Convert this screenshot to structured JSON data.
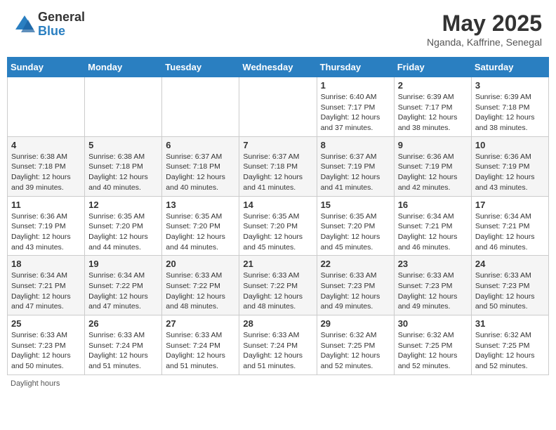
{
  "header": {
    "logo_general": "General",
    "logo_blue": "Blue",
    "month_year": "May 2025",
    "location": "Nganda, Kaffrine, Senegal"
  },
  "days_of_week": [
    "Sunday",
    "Monday",
    "Tuesday",
    "Wednesday",
    "Thursday",
    "Friday",
    "Saturday"
  ],
  "weeks": [
    [
      {
        "day": "",
        "info": ""
      },
      {
        "day": "",
        "info": ""
      },
      {
        "day": "",
        "info": ""
      },
      {
        "day": "",
        "info": ""
      },
      {
        "day": "1",
        "info": "Sunrise: 6:40 AM\nSunset: 7:17 PM\nDaylight: 12 hours and 37 minutes."
      },
      {
        "day": "2",
        "info": "Sunrise: 6:39 AM\nSunset: 7:17 PM\nDaylight: 12 hours and 38 minutes."
      },
      {
        "day": "3",
        "info": "Sunrise: 6:39 AM\nSunset: 7:18 PM\nDaylight: 12 hours and 38 minutes."
      }
    ],
    [
      {
        "day": "4",
        "info": "Sunrise: 6:38 AM\nSunset: 7:18 PM\nDaylight: 12 hours and 39 minutes."
      },
      {
        "day": "5",
        "info": "Sunrise: 6:38 AM\nSunset: 7:18 PM\nDaylight: 12 hours and 40 minutes."
      },
      {
        "day": "6",
        "info": "Sunrise: 6:37 AM\nSunset: 7:18 PM\nDaylight: 12 hours and 40 minutes."
      },
      {
        "day": "7",
        "info": "Sunrise: 6:37 AM\nSunset: 7:18 PM\nDaylight: 12 hours and 41 minutes."
      },
      {
        "day": "8",
        "info": "Sunrise: 6:37 AM\nSunset: 7:19 PM\nDaylight: 12 hours and 41 minutes."
      },
      {
        "day": "9",
        "info": "Sunrise: 6:36 AM\nSunset: 7:19 PM\nDaylight: 12 hours and 42 minutes."
      },
      {
        "day": "10",
        "info": "Sunrise: 6:36 AM\nSunset: 7:19 PM\nDaylight: 12 hours and 43 minutes."
      }
    ],
    [
      {
        "day": "11",
        "info": "Sunrise: 6:36 AM\nSunset: 7:19 PM\nDaylight: 12 hours and 43 minutes."
      },
      {
        "day": "12",
        "info": "Sunrise: 6:35 AM\nSunset: 7:20 PM\nDaylight: 12 hours and 44 minutes."
      },
      {
        "day": "13",
        "info": "Sunrise: 6:35 AM\nSunset: 7:20 PM\nDaylight: 12 hours and 44 minutes."
      },
      {
        "day": "14",
        "info": "Sunrise: 6:35 AM\nSunset: 7:20 PM\nDaylight: 12 hours and 45 minutes."
      },
      {
        "day": "15",
        "info": "Sunrise: 6:35 AM\nSunset: 7:20 PM\nDaylight: 12 hours and 45 minutes."
      },
      {
        "day": "16",
        "info": "Sunrise: 6:34 AM\nSunset: 7:21 PM\nDaylight: 12 hours and 46 minutes."
      },
      {
        "day": "17",
        "info": "Sunrise: 6:34 AM\nSunset: 7:21 PM\nDaylight: 12 hours and 46 minutes."
      }
    ],
    [
      {
        "day": "18",
        "info": "Sunrise: 6:34 AM\nSunset: 7:21 PM\nDaylight: 12 hours and 47 minutes."
      },
      {
        "day": "19",
        "info": "Sunrise: 6:34 AM\nSunset: 7:22 PM\nDaylight: 12 hours and 47 minutes."
      },
      {
        "day": "20",
        "info": "Sunrise: 6:33 AM\nSunset: 7:22 PM\nDaylight: 12 hours and 48 minutes."
      },
      {
        "day": "21",
        "info": "Sunrise: 6:33 AM\nSunset: 7:22 PM\nDaylight: 12 hours and 48 minutes."
      },
      {
        "day": "22",
        "info": "Sunrise: 6:33 AM\nSunset: 7:23 PM\nDaylight: 12 hours and 49 minutes."
      },
      {
        "day": "23",
        "info": "Sunrise: 6:33 AM\nSunset: 7:23 PM\nDaylight: 12 hours and 49 minutes."
      },
      {
        "day": "24",
        "info": "Sunrise: 6:33 AM\nSunset: 7:23 PM\nDaylight: 12 hours and 50 minutes."
      }
    ],
    [
      {
        "day": "25",
        "info": "Sunrise: 6:33 AM\nSunset: 7:23 PM\nDaylight: 12 hours and 50 minutes."
      },
      {
        "day": "26",
        "info": "Sunrise: 6:33 AM\nSunset: 7:24 PM\nDaylight: 12 hours and 51 minutes."
      },
      {
        "day": "27",
        "info": "Sunrise: 6:33 AM\nSunset: 7:24 PM\nDaylight: 12 hours and 51 minutes."
      },
      {
        "day": "28",
        "info": "Sunrise: 6:33 AM\nSunset: 7:24 PM\nDaylight: 12 hours and 51 minutes."
      },
      {
        "day": "29",
        "info": "Sunrise: 6:32 AM\nSunset: 7:25 PM\nDaylight: 12 hours and 52 minutes."
      },
      {
        "day": "30",
        "info": "Sunrise: 6:32 AM\nSunset: 7:25 PM\nDaylight: 12 hours and 52 minutes."
      },
      {
        "day": "31",
        "info": "Sunrise: 6:32 AM\nSunset: 7:25 PM\nDaylight: 12 hours and 52 minutes."
      }
    ]
  ],
  "footer": {
    "daylight_hours_label": "Daylight hours"
  }
}
